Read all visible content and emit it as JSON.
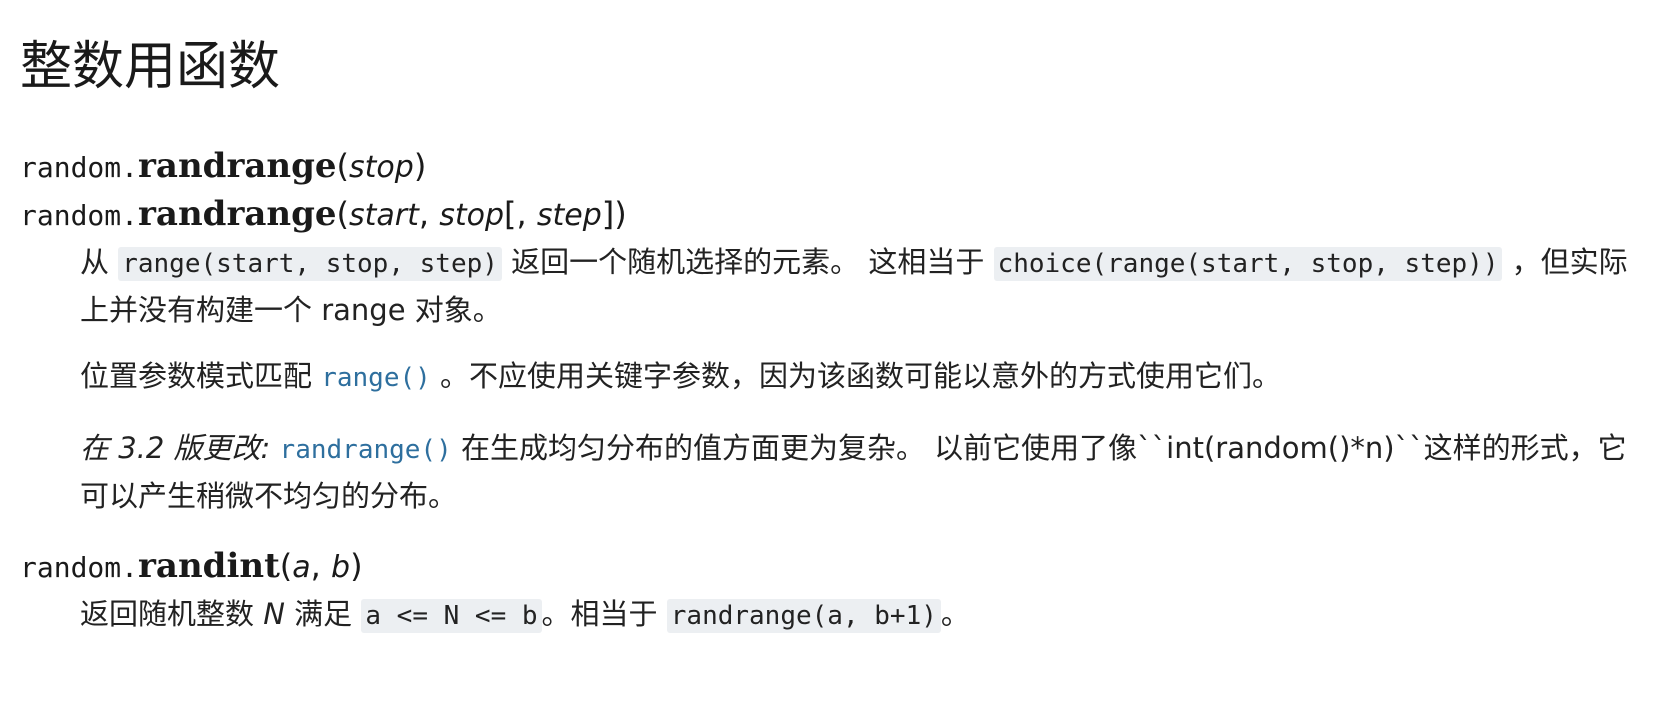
{
  "heading": "整数用函数",
  "sig1": {
    "prefix": "random.",
    "name": "randrange",
    "open": "(",
    "stop": "stop",
    "close": ")"
  },
  "sig2": {
    "prefix": "random.",
    "name": "randrange",
    "open": "(",
    "start": "start",
    "comma1": ", ",
    "stop": "stop",
    "bracket_open": "[, ",
    "step": "step",
    "close": "])"
  },
  "p1": {
    "t1": "从 ",
    "code1": "range(start, stop, step)",
    "t2": " 返回一个随机选择的元素。 这相当于 ",
    "code2": "choice(range(start, stop, step))",
    "t3": " ，但实际上并没有构建一个 range 对象。"
  },
  "p2": {
    "t1": "位置参数模式匹配 ",
    "link": "range()",
    "t2": " 。不应使用关键字参数，因为该函数可能以意外的方式使用它们。"
  },
  "p3": {
    "versionchanged": "在 3.2 版更改: ",
    "link": "randrange()",
    "t1": " 在生成均匀分布的值方面更为复杂。 以前它使用了像``int(random()*n)``这样的形式，它可以产生稍微不均匀的分布。"
  },
  "sig3": {
    "prefix": "random.",
    "name": "randint",
    "open": "(",
    "a": "a",
    "comma": ", ",
    "b": "b",
    "close": ")"
  },
  "p4": {
    "t1": "返回随机整数 ",
    "n": "N",
    "t2": " 满足 ",
    "code1": "a <= N <= b",
    "t3": "。相当于 ",
    "code2": "randrange(a, b+1)",
    "t4": "。"
  }
}
